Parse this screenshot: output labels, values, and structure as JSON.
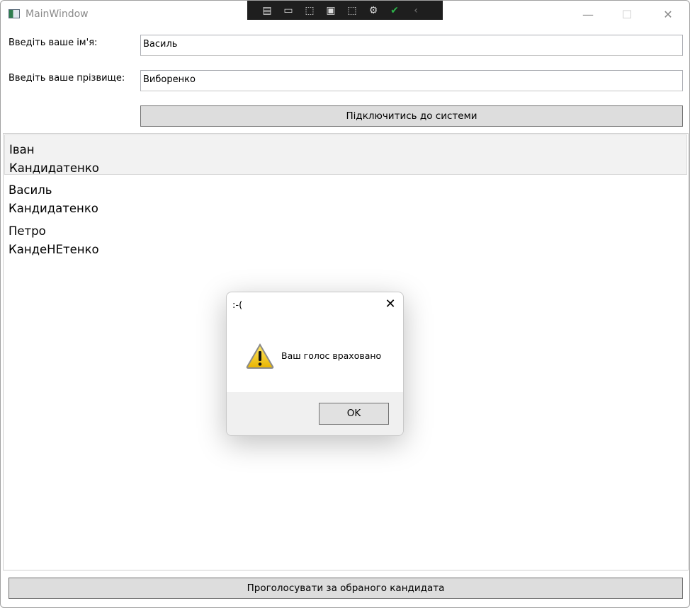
{
  "window": {
    "title": "MainWindow",
    "minimize": "—",
    "maximize": "☐",
    "close": "✕"
  },
  "debug_toolbar": {
    "icons": [
      "live-visual-tree-icon",
      "record-icon",
      "select-element-icon",
      "display-layout-adorners-icon",
      "track-focus-icon",
      "hot-reload-icon",
      "binding-check-icon",
      "collapse-icon"
    ]
  },
  "form": {
    "first_name_label": "Введіть ваше ім'я:",
    "first_name_value": "Василь",
    "last_name_label": "Введіть ваше прізвище:",
    "last_name_value": "Виборенко",
    "connect_button": "Підключитись до системи"
  },
  "candidates": [
    {
      "first": "Іван",
      "last": "Кандидатенко",
      "selected": true
    },
    {
      "first": "Василь",
      "last": "Кандидатенко",
      "selected": false
    },
    {
      "first": "Петро",
      "last": "КандеНЕтенко",
      "selected": false
    }
  ],
  "vote_button": "Проголосувати за обраного кандидата",
  "dialog": {
    "title": ":-(",
    "message": "Ваш голос враховано",
    "ok": "OK",
    "close": "✕",
    "icon": "warning-icon"
  }
}
